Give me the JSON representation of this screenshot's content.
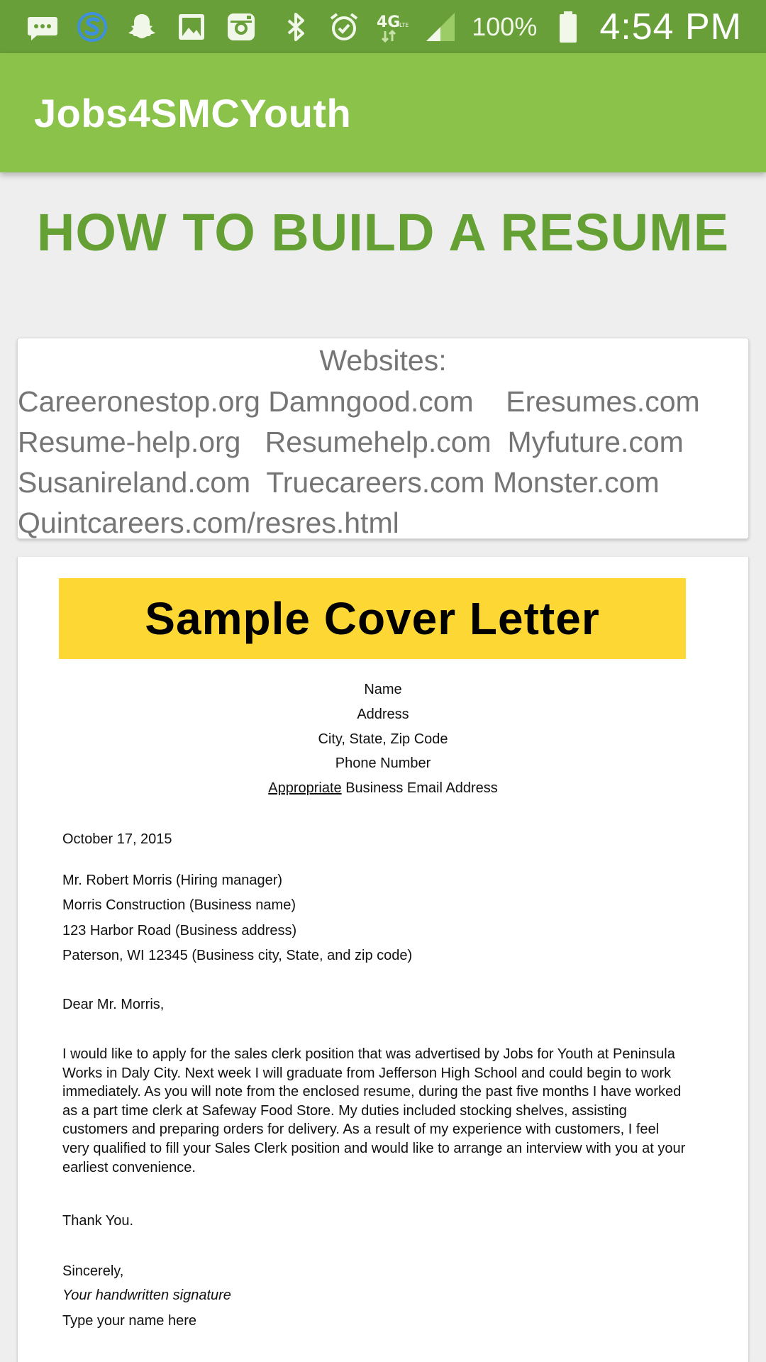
{
  "status_bar": {
    "icons": [
      "message-icon",
      "sync-app-icon",
      "snapchat-icon",
      "gallery-icon",
      "instagram-icon",
      "bluetooth-icon",
      "alarm-icon",
      "network-4g-lte-icon",
      "signal-icon",
      "battery-icon"
    ],
    "battery_level": "100%",
    "time": "4:54 PM"
  },
  "app_bar": {
    "title": "Jobs4SMCYouth"
  },
  "page": {
    "title": "HOW TO BUILD A RESUME"
  },
  "websites": {
    "heading": "Websites:",
    "lines": [
      "Careeronestop.org Damngood.com    Eresumes.com",
      "Resume-help.org   Resumehelp.com  Myfuture.com",
      "Susanireland.com  Truecareers.com Monster.com",
      "Quintcareers.com/resres.html"
    ]
  },
  "cover_letter": {
    "banner": "Sample Cover Letter",
    "header_lines": [
      "Name",
      "Address",
      "City, State, Zip Code",
      "Phone Number"
    ],
    "email_underlined": "Appropriate",
    "email_rest": " Business Email Address",
    "date": "October 17, 2015",
    "recipient": [
      "Mr. Robert Morris (Hiring manager)",
      "Morris Construction (Business name)",
      "123 Harbor Road (Business address)",
      "Paterson, WI 12345 (Business city, State, and zip code)"
    ],
    "salutation": "Dear Mr. Morris,",
    "body": "I would like to apply for the sales clerk position that was advertised by Jobs for Youth at Peninsula Works in Daly City.  Next week I will graduate from Jefferson High School and could begin to work immediately. As you will note from the enclosed resume, during the past five months I have worked as a part time clerk at Safeway Food Store.  My duties included stocking shelves, assisting customers and preparing orders for delivery.  As a result of my experience with customers, I feel very qualified to fill your Sales Clerk position and would like to arrange an interview with you at your earliest convenience.",
    "thanks": "Thank You.",
    "closing": "Sincerely,",
    "signature": "Your handwritten signature",
    "typed_name": "Type your name here"
  }
}
